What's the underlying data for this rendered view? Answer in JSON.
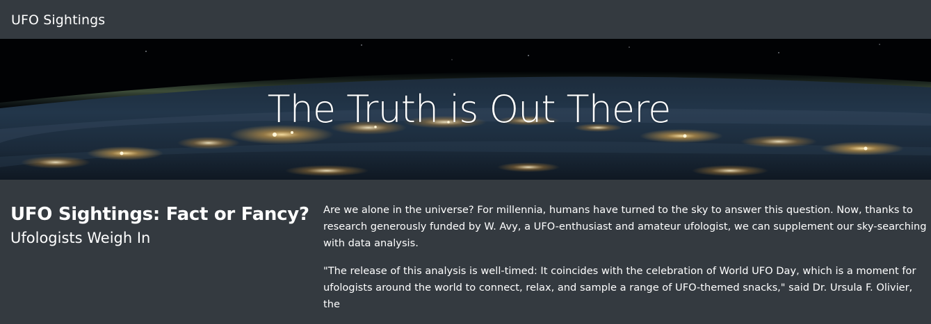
{
  "navbar": {
    "brand": "UFO Sightings"
  },
  "hero": {
    "title": "The Truth is Out There"
  },
  "article": {
    "title": "UFO Sightings: Fact or Fancy?",
    "subtitle": "Ufologists Weigh In",
    "paragraphs": [
      "Are we alone in the universe? For millennia, humans have turned to the sky to answer this question. Now, thanks to research generously funded by W. Avy, a UFO-enthusiast and amateur ufologist, we can supplement our sky-searching with data analysis.",
      "\"The release of this analysis is well-timed: It coincides with the celebration of World UFO Day, which is a moment for ufologists around the world to connect, relax, and sample a range of UFO-themed snacks,\" said Dr. Ursula F. Olivier, the"
    ]
  },
  "colors": {
    "background": "#343a40",
    "text": "#ffffff",
    "hero_space": "#000000"
  }
}
